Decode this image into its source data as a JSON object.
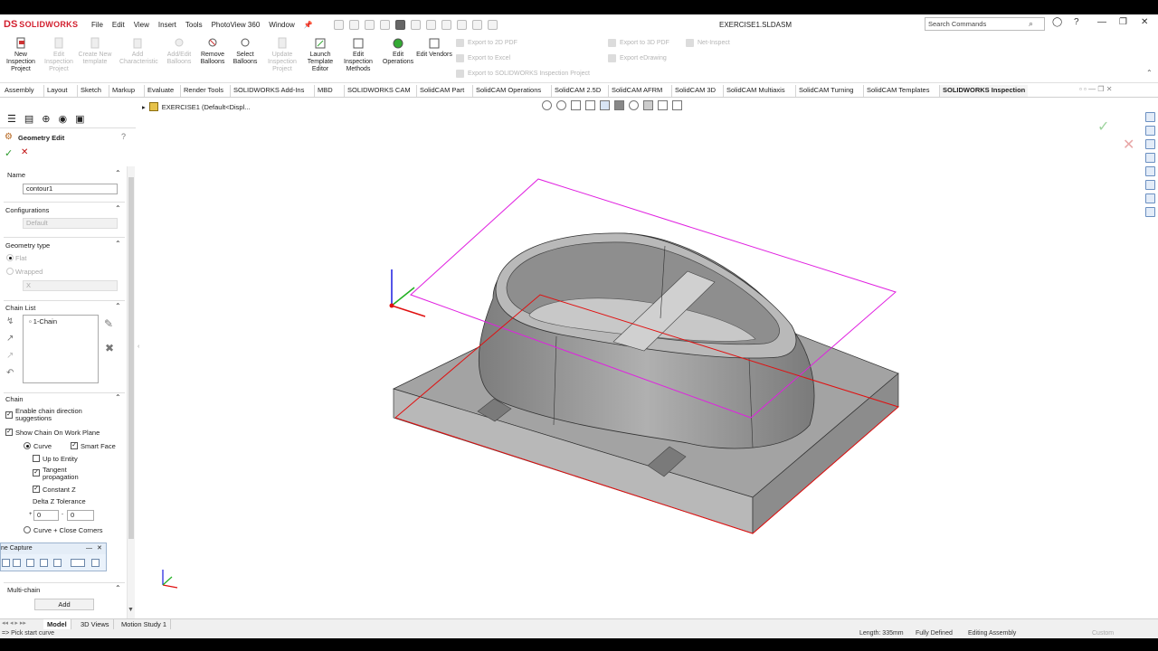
{
  "app": {
    "logo_ds": "DS",
    "logo_name": "SOLIDWORKS",
    "document_title": "EXERCISE1.SLDASM"
  },
  "menu": [
    "File",
    "Edit",
    "View",
    "Insert",
    "Tools",
    "PhotoView 360",
    "Window"
  ],
  "search": {
    "placeholder": "Search Commands"
  },
  "ribbon": {
    "buttons": [
      {
        "label": "New Inspection Project",
        "enabled": true
      },
      {
        "label": "Edit Inspection Project",
        "enabled": false
      },
      {
        "label": "Create New template",
        "enabled": false
      },
      {
        "label": "Add Characteristic",
        "enabled": false
      },
      {
        "label": "Add/Edit Balloons",
        "enabled": false
      },
      {
        "label": "Remove Balloons",
        "enabled": true
      },
      {
        "label": "Select Balloons",
        "enabled": true
      },
      {
        "label": "Update Inspection Project",
        "enabled": false
      },
      {
        "label": "Launch Template Editor",
        "enabled": true
      },
      {
        "label": "Edit Inspection Methods",
        "enabled": true
      },
      {
        "label": "Edit Operations",
        "enabled": true
      },
      {
        "label": "Edit Vendors",
        "enabled": true
      }
    ],
    "exports": [
      "Export to 2D PDF",
      "Export to Excel",
      "Export to SOLIDWORKS Inspection Project",
      "Export to 3D PDF",
      "Export eDrawing",
      "Net-Inspect"
    ]
  },
  "tabs": [
    "Assembly",
    "Layout",
    "Sketch",
    "Markup",
    "Evaluate",
    "Render Tools",
    "SOLIDWORKS Add-Ins",
    "MBD",
    "SOLIDWORKS CAM",
    "SolidCAM Part",
    "SolidCAM Operations",
    "SolidCAM 2.5D",
    "SolidCAM AFRM",
    "SolidCAM 3D",
    "SolidCAM Multiaxis",
    "SolidCAM Turning",
    "SolidCAM Templates",
    "SOLIDWORKS Inspection"
  ],
  "active_tab": "SOLIDWORKS Inspection",
  "panel": {
    "title": "Geometry Edit",
    "name_section": "Name",
    "name_value": "contour1",
    "configurations_section": "Configurations",
    "configuration_value": "Default",
    "geometry_type_section": "Geometry type",
    "flat_label": "Flat",
    "wrapped_label": "Wrapped",
    "axis_value": "X",
    "chain_list_section": "Chain List",
    "chain_item": "1-Chain",
    "chain_section": "Chain",
    "enable_direction_label": "Enable chain direction suggestions",
    "show_chain_label": "Show Chain On Work Plane",
    "curve_label": "Curve",
    "smart_face_label": "Smart Face",
    "up_to_entity_label": "Up to Entity",
    "tangent_label": "Tangent propagation",
    "constant_z_label": "Constant Z",
    "delta_z_label": "Delta Z Tolerance",
    "delta_z_min": "0",
    "delta_z_max": "0",
    "curve_close_corners_label": "Curve + Close Corners",
    "multichain_section": "Multi-chain",
    "add_button": "Add"
  },
  "capture_toolbar": {
    "title": "ne Capture"
  },
  "breadcrumb": {
    "text": "EXERCISE1  (Default<Displ..."
  },
  "bottom_tabs": [
    "Model",
    "3D Views",
    "Motion Study 1"
  ],
  "status": {
    "prompt": "=> Pick start curve",
    "length": "Length: 335mm",
    "state": "Fully Defined",
    "mode": "Editing Assembly",
    "units": "Custom"
  },
  "colors": {
    "accent_red": "#d21f2e",
    "wire_magenta": "#e020e0",
    "chain_red": "#e01010",
    "part_gray": "#9d9d9d"
  }
}
